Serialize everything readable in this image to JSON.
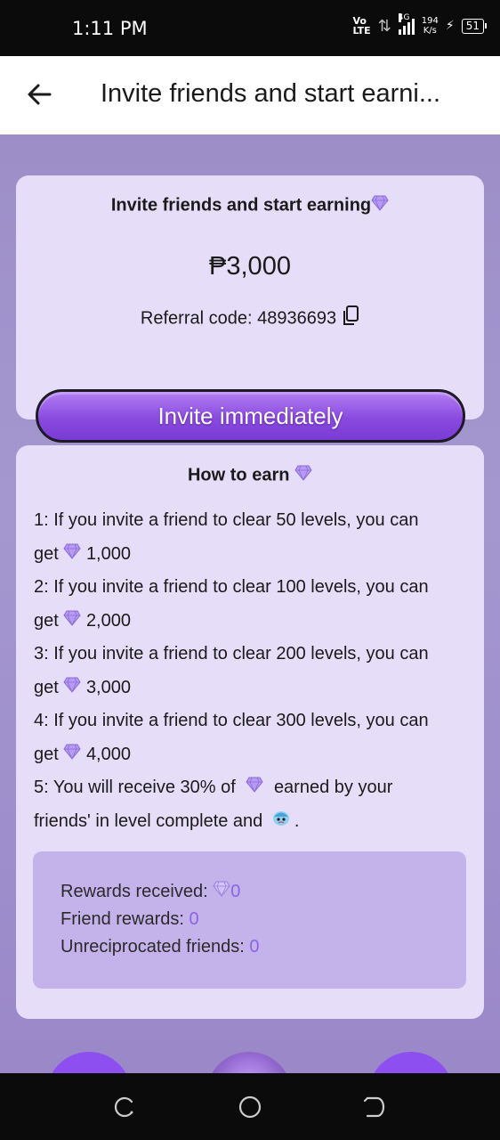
{
  "status_bar": {
    "time": "1:11 PM",
    "volte_top": "Vo",
    "volte_bottom": "LTE",
    "network": "4G",
    "speed_value": "194",
    "speed_unit": "K/s",
    "battery": "51"
  },
  "header": {
    "title": "Invite friends and start earni..."
  },
  "invite_card": {
    "title": "Invite friends and start earning",
    "amount": "₱3,000",
    "referral_label": "Referral code: 48936693",
    "button_label": "Invite immediately"
  },
  "earn_card": {
    "title": "How to earn",
    "rules": {
      "r1a": "1: If you invite a friend to clear 50 levels, you can",
      "r1b_pre": "get",
      "r1b_val": "1,000",
      "r2a": "2: If you invite a friend to clear 100 levels, you can",
      "r2b_pre": "get",
      "r2b_val": "2,000",
      "r3a": "3: If you invite a friend to clear 200 levels, you can",
      "r3b_pre": "get",
      "r3b_val": "3,000",
      "r4a": "4: If you invite a friend to clear 300 levels, you can",
      "r4b_pre": "get",
      "r4b_val": "4,000",
      "r5a_pre": "5: You will receive 30% of",
      "r5a_post": "earned by your",
      "r5b_pre": "friends' in level complete and",
      "r5b_post": "."
    },
    "rewards": {
      "received_label": "Rewards received:",
      "received_value": "0",
      "friend_label": "Friend rewards:",
      "friend_value": "0",
      "unreciprocated_label": "Unreciprocated friends:",
      "unreciprocated_value": "0"
    }
  },
  "colors": {
    "accent": "#8a4ae0",
    "card": "#e6ddf9",
    "reward_value": "#8c63e6"
  },
  "icons": {
    "gem": "diamond-gem-icon",
    "copy": "copy-icon",
    "back": "arrow-left-icon",
    "character": "character-face-icon"
  }
}
